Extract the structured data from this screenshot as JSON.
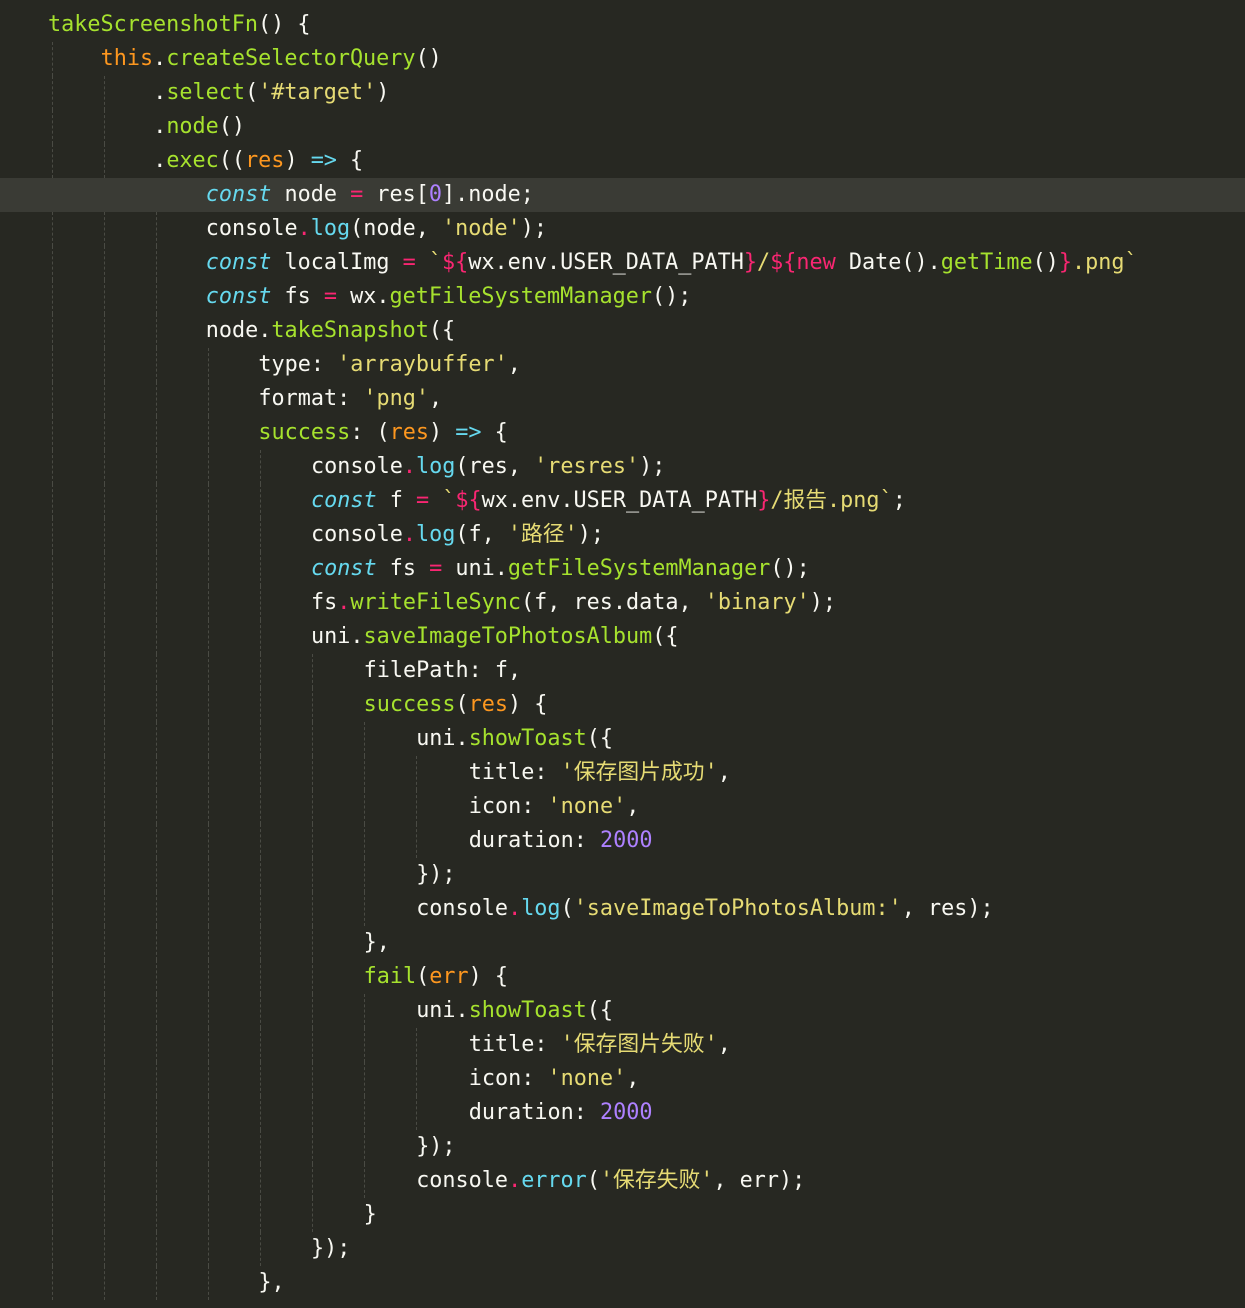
{
  "editor": {
    "theme": "dark",
    "colors": {
      "background": "#272822",
      "active_line": "#3a3b35",
      "plain": "#f8f8f2",
      "function": "#a6e22e",
      "this_keyword": "#fd971f",
      "string": "#e6db74",
      "number": "#ae81ff",
      "storage": "#66d9ef",
      "operator": "#f92672",
      "parameter": "#fd971f"
    },
    "active_line_index": 5,
    "lines": [
      {
        "indent": 0,
        "tokens": [
          {
            "t": "takeScreenshotFn",
            "k": "fn"
          },
          {
            "t": "() {",
            "k": "plain"
          }
        ]
      },
      {
        "indent": 1,
        "tokens": [
          {
            "t": "this",
            "k": "kw"
          },
          {
            "t": ".",
            "k": "plain"
          },
          {
            "t": "createSelectorQuery",
            "k": "fn"
          },
          {
            "t": "()",
            "k": "plain"
          }
        ]
      },
      {
        "indent": 2,
        "tokens": [
          {
            "t": ".",
            "k": "plain"
          },
          {
            "t": "select",
            "k": "fn"
          },
          {
            "t": "(",
            "k": "plain"
          },
          {
            "t": "'#target'",
            "k": "str"
          },
          {
            "t": ")",
            "k": "plain"
          }
        ]
      },
      {
        "indent": 2,
        "tokens": [
          {
            "t": ".",
            "k": "plain"
          },
          {
            "t": "node",
            "k": "fn"
          },
          {
            "t": "()",
            "k": "plain"
          }
        ]
      },
      {
        "indent": 2,
        "tokens": [
          {
            "t": ".",
            "k": "plain"
          },
          {
            "t": "exec",
            "k": "fn"
          },
          {
            "t": "((",
            "k": "plain"
          },
          {
            "t": "res",
            "k": "prm"
          },
          {
            "t": ") ",
            "k": "plain"
          },
          {
            "t": "=>",
            "k": "st"
          },
          {
            "t": " {",
            "k": "plain"
          }
        ]
      },
      {
        "indent": 3,
        "tokens": [
          {
            "t": "const",
            "k": "st",
            "i": true
          },
          {
            "t": " node ",
            "k": "plain"
          },
          {
            "t": "=",
            "k": "op"
          },
          {
            "t": " res[",
            "k": "plain"
          },
          {
            "t": "0",
            "k": "num"
          },
          {
            "t": "].node;",
            "k": "plain"
          }
        ]
      },
      {
        "indent": 3,
        "tokens": [
          {
            "t": "console",
            "k": "plain"
          },
          {
            "t": ".",
            "k": "dot"
          },
          {
            "t": "log",
            "k": "meth"
          },
          {
            "t": "(node, ",
            "k": "plain"
          },
          {
            "t": "'node'",
            "k": "str"
          },
          {
            "t": ");",
            "k": "plain"
          }
        ]
      },
      {
        "indent": 3,
        "tokens": [
          {
            "t": "const",
            "k": "st",
            "i": true
          },
          {
            "t": " localImg ",
            "k": "plain"
          },
          {
            "t": "=",
            "k": "op"
          },
          {
            "t": " `",
            "k": "str"
          },
          {
            "t": "${",
            "k": "tpl"
          },
          {
            "t": "wx.env.USER_DATA_PATH",
            "k": "plain"
          },
          {
            "t": "}",
            "k": "tpl"
          },
          {
            "t": "/",
            "k": "str"
          },
          {
            "t": "${",
            "k": "tpl"
          },
          {
            "t": "new",
            "k": "op"
          },
          {
            "t": " Date().",
            "k": "plain"
          },
          {
            "t": "getTime",
            "k": "fn"
          },
          {
            "t": "()",
            "k": "plain"
          },
          {
            "t": "}",
            "k": "tpl"
          },
          {
            "t": ".png`",
            "k": "str"
          }
        ]
      },
      {
        "indent": 3,
        "tokens": [
          {
            "t": "const",
            "k": "st",
            "i": true
          },
          {
            "t": " fs ",
            "k": "plain"
          },
          {
            "t": "=",
            "k": "op"
          },
          {
            "t": " wx.",
            "k": "plain"
          },
          {
            "t": "getFileSystemManager",
            "k": "fn"
          },
          {
            "t": "();",
            "k": "plain"
          }
        ]
      },
      {
        "indent": 3,
        "tokens": [
          {
            "t": "node.",
            "k": "plain"
          },
          {
            "t": "takeSnapshot",
            "k": "fn"
          },
          {
            "t": "({",
            "k": "plain"
          }
        ]
      },
      {
        "indent": 4,
        "tokens": [
          {
            "t": "type: ",
            "k": "plain"
          },
          {
            "t": "'arraybuffer'",
            "k": "str"
          },
          {
            "t": ",",
            "k": "plain"
          }
        ]
      },
      {
        "indent": 4,
        "tokens": [
          {
            "t": "format: ",
            "k": "plain"
          },
          {
            "t": "'png'",
            "k": "str"
          },
          {
            "t": ",",
            "k": "plain"
          }
        ]
      },
      {
        "indent": 4,
        "tokens": [
          {
            "t": "success",
            "k": "fn"
          },
          {
            "t": ": (",
            "k": "plain"
          },
          {
            "t": "res",
            "k": "prm"
          },
          {
            "t": ") ",
            "k": "plain"
          },
          {
            "t": "=>",
            "k": "st"
          },
          {
            "t": " {",
            "k": "plain"
          }
        ]
      },
      {
        "indent": 5,
        "tokens": [
          {
            "t": "console",
            "k": "plain"
          },
          {
            "t": ".",
            "k": "dot"
          },
          {
            "t": "log",
            "k": "meth"
          },
          {
            "t": "(res, ",
            "k": "plain"
          },
          {
            "t": "'resres'",
            "k": "str"
          },
          {
            "t": ");",
            "k": "plain"
          }
        ]
      },
      {
        "indent": 5,
        "tokens": [
          {
            "t": "const",
            "k": "st",
            "i": true
          },
          {
            "t": " f ",
            "k": "plain"
          },
          {
            "t": "=",
            "k": "op"
          },
          {
            "t": " `",
            "k": "str"
          },
          {
            "t": "${",
            "k": "tpl"
          },
          {
            "t": "wx.env.USER_DATA_PATH",
            "k": "plain"
          },
          {
            "t": "}",
            "k": "tpl"
          },
          {
            "t": "/报告.png`",
            "k": "str"
          },
          {
            "t": ";",
            "k": "plain"
          }
        ]
      },
      {
        "indent": 5,
        "tokens": [
          {
            "t": "console",
            "k": "plain"
          },
          {
            "t": ".",
            "k": "dot"
          },
          {
            "t": "log",
            "k": "meth"
          },
          {
            "t": "(f, ",
            "k": "plain"
          },
          {
            "t": "'路径'",
            "k": "str"
          },
          {
            "t": ");",
            "k": "plain"
          }
        ]
      },
      {
        "indent": 5,
        "tokens": [
          {
            "t": "const",
            "k": "st",
            "i": true
          },
          {
            "t": " fs ",
            "k": "plain"
          },
          {
            "t": "=",
            "k": "op"
          },
          {
            "t": " uni.",
            "k": "plain"
          },
          {
            "t": "getFileSystemManager",
            "k": "fn"
          },
          {
            "t": "();",
            "k": "plain"
          }
        ]
      },
      {
        "indent": 5,
        "tokens": [
          {
            "t": "fs",
            "k": "plain"
          },
          {
            "t": ".",
            "k": "dot"
          },
          {
            "t": "writeFileSync",
            "k": "fn"
          },
          {
            "t": "(f, res.data, ",
            "k": "plain"
          },
          {
            "t": "'binary'",
            "k": "str"
          },
          {
            "t": ");",
            "k": "plain"
          }
        ]
      },
      {
        "indent": 5,
        "tokens": [
          {
            "t": "uni.",
            "k": "plain"
          },
          {
            "t": "saveImageToPhotosAlbum",
            "k": "fn"
          },
          {
            "t": "({",
            "k": "plain"
          }
        ]
      },
      {
        "indent": 6,
        "tokens": [
          {
            "t": "filePath: f,",
            "k": "plain"
          }
        ]
      },
      {
        "indent": 6,
        "tokens": [
          {
            "t": "success",
            "k": "fn"
          },
          {
            "t": "(",
            "k": "plain"
          },
          {
            "t": "res",
            "k": "prm"
          },
          {
            "t": ") {",
            "k": "plain"
          }
        ]
      },
      {
        "indent": 7,
        "tokens": [
          {
            "t": "uni.",
            "k": "plain"
          },
          {
            "t": "showToast",
            "k": "fn"
          },
          {
            "t": "({",
            "k": "plain"
          }
        ]
      },
      {
        "indent": 8,
        "tokens": [
          {
            "t": "title: ",
            "k": "plain"
          },
          {
            "t": "'保存图片成功'",
            "k": "str"
          },
          {
            "t": ",",
            "k": "plain"
          }
        ]
      },
      {
        "indent": 8,
        "tokens": [
          {
            "t": "icon: ",
            "k": "plain"
          },
          {
            "t": "'none'",
            "k": "str"
          },
          {
            "t": ",",
            "k": "plain"
          }
        ]
      },
      {
        "indent": 8,
        "tokens": [
          {
            "t": "duration: ",
            "k": "plain"
          },
          {
            "t": "2000",
            "k": "num"
          }
        ]
      },
      {
        "indent": 7,
        "tokens": [
          {
            "t": "});",
            "k": "plain"
          }
        ]
      },
      {
        "indent": 7,
        "tokens": [
          {
            "t": "console",
            "k": "plain"
          },
          {
            "t": ".",
            "k": "dot"
          },
          {
            "t": "log",
            "k": "meth"
          },
          {
            "t": "(",
            "k": "plain"
          },
          {
            "t": "'saveImageToPhotosAlbum:'",
            "k": "str"
          },
          {
            "t": ", res);",
            "k": "plain"
          }
        ]
      },
      {
        "indent": 6,
        "tokens": [
          {
            "t": "},",
            "k": "plain"
          }
        ]
      },
      {
        "indent": 6,
        "tokens": [
          {
            "t": "fail",
            "k": "fn"
          },
          {
            "t": "(",
            "k": "plain"
          },
          {
            "t": "err",
            "k": "prm"
          },
          {
            "t": ") {",
            "k": "plain"
          }
        ]
      },
      {
        "indent": 7,
        "tokens": [
          {
            "t": "uni.",
            "k": "plain"
          },
          {
            "t": "showToast",
            "k": "fn"
          },
          {
            "t": "({",
            "k": "plain"
          }
        ]
      },
      {
        "indent": 8,
        "tokens": [
          {
            "t": "title: ",
            "k": "plain"
          },
          {
            "t": "'保存图片失败'",
            "k": "str"
          },
          {
            "t": ",",
            "k": "plain"
          }
        ]
      },
      {
        "indent": 8,
        "tokens": [
          {
            "t": "icon: ",
            "k": "plain"
          },
          {
            "t": "'none'",
            "k": "str"
          },
          {
            "t": ",",
            "k": "plain"
          }
        ]
      },
      {
        "indent": 8,
        "tokens": [
          {
            "t": "duration: ",
            "k": "plain"
          },
          {
            "t": "2000",
            "k": "num"
          }
        ]
      },
      {
        "indent": 7,
        "tokens": [
          {
            "t": "});",
            "k": "plain"
          }
        ]
      },
      {
        "indent": 7,
        "tokens": [
          {
            "t": "console",
            "k": "plain"
          },
          {
            "t": ".",
            "k": "dot"
          },
          {
            "t": "error",
            "k": "meth"
          },
          {
            "t": "(",
            "k": "plain"
          },
          {
            "t": "'保存失败'",
            "k": "str"
          },
          {
            "t": ", err);",
            "k": "plain"
          }
        ]
      },
      {
        "indent": 6,
        "tokens": [
          {
            "t": "}",
            "k": "plain"
          }
        ]
      },
      {
        "indent": 5,
        "tokens": [
          {
            "t": "});",
            "k": "plain"
          }
        ]
      },
      {
        "indent": 4,
        "tokens": [
          {
            "t": "},",
            "k": "plain"
          }
        ]
      }
    ]
  }
}
